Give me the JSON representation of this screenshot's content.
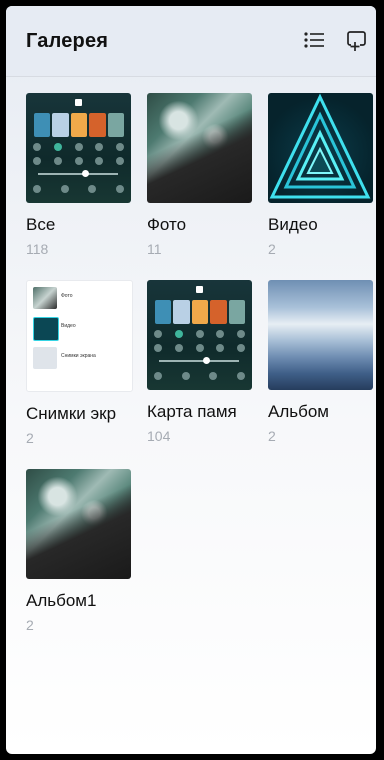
{
  "header": {
    "title": "Галерея",
    "list_view_icon": "list-view-icon",
    "new_album_icon": "new-album-icon"
  },
  "albums": [
    {
      "name": "Все",
      "count": "118",
      "thumb": "ui-screenshot"
    },
    {
      "name": "Фото",
      "count": "11",
      "thumb": "ocean-waves"
    },
    {
      "name": "Видео",
      "count": "2",
      "thumb": "neon-triangles"
    },
    {
      "name": "Снимки экр",
      "count": "2",
      "thumb": "album-list-screenshot"
    },
    {
      "name": "Карта памя",
      "count": "104",
      "thumb": "ui-screenshot"
    },
    {
      "name": "Альбом",
      "count": "2",
      "thumb": "sky-clouds"
    },
    {
      "name": "Альбом1",
      "count": "2",
      "thumb": "ocean-waves"
    }
  ],
  "thumb_list_labels": {
    "row1": "Фото",
    "row2": "Видео",
    "row3": "Снимки экрана"
  },
  "colors": {
    "header_bg": "#e6ebf3",
    "count_text": "#a6abb3",
    "accent_neon": "#38d6e6"
  }
}
